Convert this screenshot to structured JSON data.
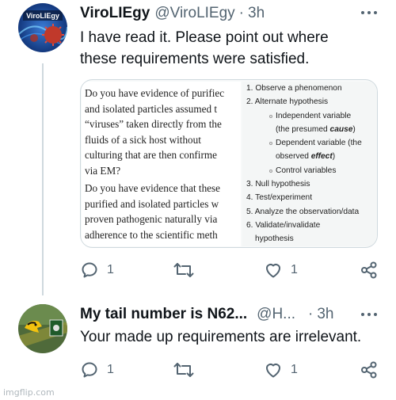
{
  "tweet1": {
    "display_name": "ViroLIEgy",
    "handle": "@ViroLIEgy",
    "separator": "·",
    "time": "3h",
    "avatar_text": "ViroLIEgy",
    "text_line1": "I have read it. Please point out where",
    "text_line2": "these requirements were satisfied.",
    "image": {
      "left_lines": [
        "Do you have evidence of purifiec",
        "and isolated particles assumed t",
        "“viruses” taken directly from the",
        "fluids of a sick host without",
        "culturing that are then confirme",
        "via EM?",
        "Do you have evidence that these",
        "purified and isolated particles w",
        "proven pathogenic naturally via",
        "adherence to the scientific meth"
      ],
      "right": {
        "l1": "1. Observe a phenomenon",
        "l2": "2. Alternate hypothesis",
        "l2a": "Independent variable",
        "l2a_cont_prefix": "(the presumed ",
        "l2a_cont_em": "cause",
        "l2a_cont_suffix": ")",
        "l2b": "Dependent variable (the",
        "l2b_cont_prefix": "observed ",
        "l2b_cont_em": "effect",
        "l2b_cont_suffix": ")",
        "l2c": "Control variables",
        "l3": "3. Null hypothesis",
        "l4": "4. Test/experiment",
        "l5": "5. Analyze the observation/data",
        "l6": "6. Validate/invalidate",
        "l6_cont": "hypothesis"
      }
    },
    "replies_count": "1",
    "likes_count": "1"
  },
  "tweet2": {
    "display_name": "My tail number is N62...",
    "handle": "@H...",
    "separator": "·",
    "time": "3h",
    "text": "Your made up requirements are irrelevant.",
    "replies_count": "1",
    "likes_count": "1"
  },
  "icons": {
    "reply": "reply-icon",
    "retweet": "retweet-icon",
    "like": "heart-icon",
    "share": "share-icon",
    "more": "more-icon"
  },
  "colors": {
    "text": "#0f1419",
    "secondary": "#536471",
    "thread_line": "#cfd9de"
  },
  "watermark": "imgflip.com"
}
